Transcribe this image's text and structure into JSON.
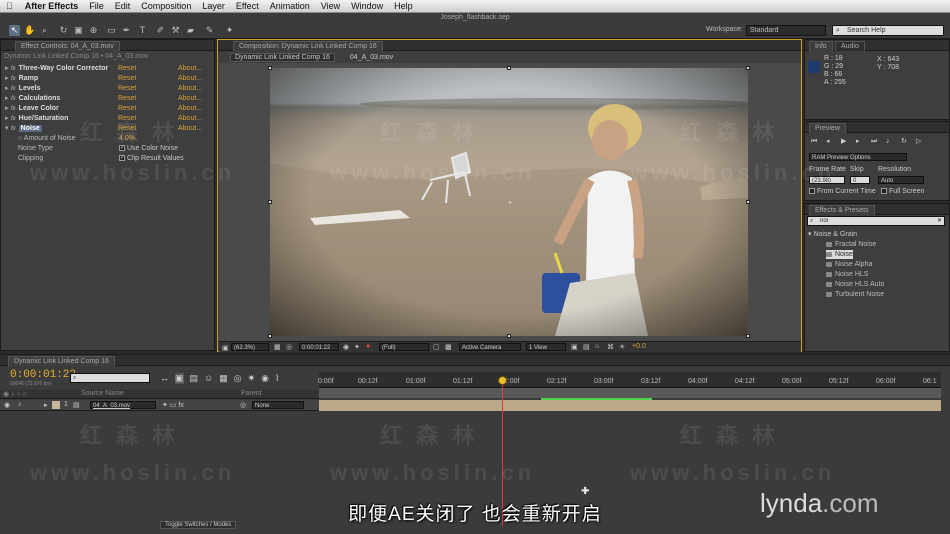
{
  "menubar": {
    "apple": "",
    "app_name": "After Effects",
    "items": [
      "File",
      "Edit",
      "Composition",
      "Layer",
      "Effect",
      "Animation",
      "View",
      "Window",
      "Help"
    ]
  },
  "toolbar": {
    "doc_title": "Joseph_flashback.sep",
    "workspace_label": "Workspace:",
    "workspace_value": "Standard",
    "search_placeholder": "Search Help"
  },
  "effect_controls": {
    "tab_label": "Effect Controls: 04_A_03.mov",
    "breadcrumb": "Dynamic Link Linked Comp 16 • 04_A_03.mov",
    "effects": [
      {
        "name": "Three-Way Color Corrector",
        "reset": "Reset",
        "about": "About..."
      },
      {
        "name": "Ramp",
        "reset": "Reset",
        "about": "About..."
      },
      {
        "name": "Levels",
        "reset": "Reset",
        "about": "About..."
      },
      {
        "name": "Calculations",
        "reset": "Reset",
        "about": "About..."
      },
      {
        "name": "Leave Color",
        "reset": "Reset",
        "about": "About..."
      },
      {
        "name": "Hue/Saturation",
        "reset": "Reset",
        "about": "About..."
      },
      {
        "name": "Noise",
        "reset": "Reset",
        "about": "About..."
      }
    ],
    "noise_props": {
      "amount_label": "Amount of Noise",
      "amount_value": "4.0%",
      "type_label": "Noise Type",
      "type_value": "Use Color Noise",
      "clip_label": "Clipping",
      "clip_value": "Clip Result Values"
    }
  },
  "composition": {
    "tab_label": "Composition: Dynamic Link Linked Comp 16",
    "sub_tab": "Dynamic Link Linked Comp 16",
    "sub_tab2": "04_A_03.mov",
    "footer": {
      "zoom": "(62.3%)",
      "timecode": "0:00:01:22",
      "resolution": "(Full)",
      "camera": "Active Camera",
      "view": "1 View",
      "exposure": "+0.0"
    }
  },
  "info": {
    "tab": "Info",
    "tab2": "Audio",
    "r": "R : 18",
    "g": "G : 29",
    "b": "B : 66",
    "a": "A : 255",
    "x": "X : 643",
    "y": "Y : 708",
    "swatch_color": "#1f3a6c"
  },
  "preview": {
    "tab": "Preview",
    "ram_options": "RAM Preview Options",
    "frame_rate_label": "Frame Rate",
    "skip_label": "Skip",
    "resolution_label": "Resolution",
    "frame_rate": "(23.98)",
    "skip": "0",
    "resolution": "Auto",
    "from_current": "From Current Time",
    "full_screen": "Full Screen"
  },
  "effects_presets": {
    "tab": "Effects & Presets",
    "search_value": "noi",
    "category": "Noise & Grain",
    "items": [
      "Fractal Noise",
      "Noise",
      "Noise Alpha",
      "Noise HLS",
      "Noise HLS Auto",
      "Turbulent Noise"
    ]
  },
  "timeline": {
    "tab": "Dynamic Link Linked Comp 16",
    "timecode": "0:00:01:22",
    "fps": "00046 (23.976 fps)",
    "col_source": "Source Name",
    "col_parent": "Parent",
    "layer_num": "1",
    "layer_name": "04_A_03.mov",
    "parent_value": "None",
    "ruler": [
      "0:00f",
      "00:12f",
      "01:00f",
      "01:12f",
      "02:00f",
      "02:12f",
      "03:00f",
      "03:12f",
      "04:00f",
      "04:12f",
      "05:00f",
      "05:12f",
      "06:00f",
      "06:1"
    ],
    "toggle": "Toggle Switches / Modes"
  },
  "subtitle": "即便AE关闭了 也会重新开启",
  "brand": {
    "name": "lynda",
    ".com": ".com"
  },
  "watermark": {
    "cn": "红 森 林",
    "url": "www.hoslin.cn"
  }
}
